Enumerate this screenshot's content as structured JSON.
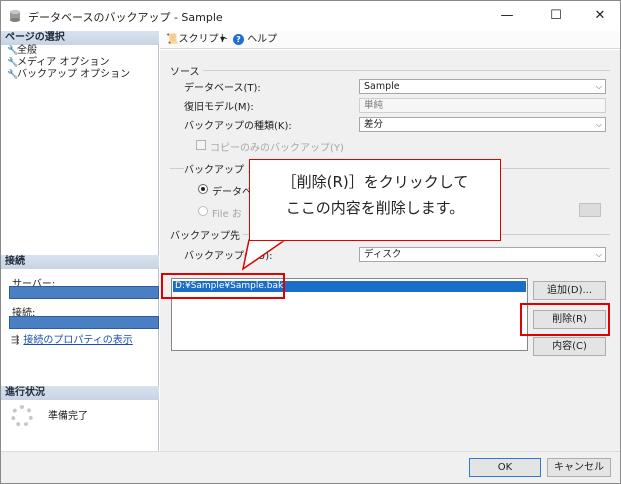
{
  "window": {
    "title": "データベースのバックアップ - Sample",
    "controls": {
      "minimize": "—",
      "maximize": "☐",
      "close": "✕"
    }
  },
  "left_pane": {
    "select_page_header": "ページの選択",
    "pages": [
      "全般",
      "メディア オプション",
      "バックアップ オプション"
    ],
    "connection_header": "接続",
    "server_label": "サーバー:",
    "connection_label": "接続:",
    "view_connection_properties": "接続のプロパティの表示",
    "progress_header": "進行状況",
    "progress_status": "準備完了"
  },
  "toolbar": {
    "script_label": "スクリプト",
    "dropdown_glyph": "▾",
    "help_icon": "?",
    "help_label": "ヘルプ"
  },
  "source": {
    "group_label": "ソース",
    "database_label": "データベース(T):",
    "database_value": "Sample",
    "recovery_model_label": "復旧モデル(M):",
    "recovery_model_value": "単純",
    "backup_type_label": "バックアップの種類(K):",
    "backup_type_value": "差分",
    "copy_only_label": "コピーのみのバックアップ(Y)"
  },
  "component": {
    "group_label_partial": "バックアップ コ",
    "database_radio_partial": "データベ",
    "file_radio_partial": "File お"
  },
  "destination": {
    "group_label": "バックアップ先",
    "backup_to_label": "バックアップ先(U):",
    "backup_to_value": "ディスク",
    "paths": [
      "D:¥Sample¥Sample.bak"
    ],
    "add_button": "追加(D)...",
    "remove_button": "削除(R)",
    "contents_button": "内容(C)"
  },
  "footer": {
    "ok": "OK",
    "cancel": "キャンセル"
  },
  "callout": {
    "line1": "［削除(R)］をクリックして",
    "line2": "ここの内容を削除します。"
  },
  "colors": {
    "annotation_red": "#e00000",
    "selection_blue": "#1a6ec7",
    "connection_bar": "#4a7fc4"
  }
}
